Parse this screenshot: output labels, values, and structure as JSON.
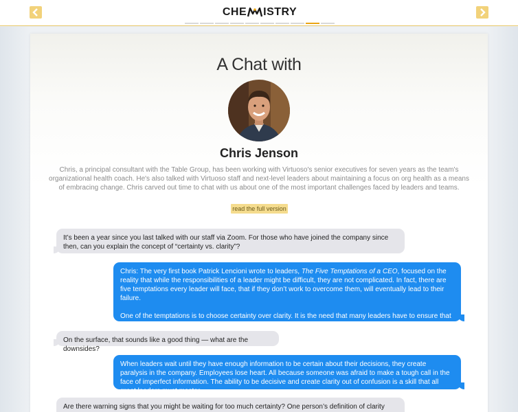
{
  "header": {
    "logo_text_left": "CHE",
    "logo_text_right": "ISTRY",
    "logo_accent_color": "#e9a412",
    "prev_icon": "chevron-left-icon",
    "next_icon": "chevron-right-icon",
    "progress": {
      "segments": 10,
      "active_index": 8
    }
  },
  "article": {
    "title": "A Chat with",
    "name": "Chris Jenson",
    "intro": "Chris, a principal consultant with the Table Group, has been working with Virtuoso's senior executives for seven years as the team's organizational health coach. He's also talked with Virtuoso staff and next-level leaders about maintaining a focus on org health as a means of embracing change. Chris carved out time to chat with us about one of the most important challenges faced by leaders and teams.",
    "read_button": "read the full version"
  },
  "chat": {
    "q1": "It’s been a year since you last talked with our staff via Zoom. For those who have joined the company since then, can you explain the concept of “certainty vs. clarity”?",
    "a1_p1_before": "Chris: The very first book Patrick Lencioni wrote to leaders, ",
    "a1_p1_book": "The Five Temptations of a CEO",
    "a1_p1_after": ", focused on the reality that while the responsibilities of a leader might be difficult, they are not complicated. In fact, there are five temptations every leader will face, that if they don’t work to overcome them, will eventually lead to their failure.",
    "a1_p2": "One of the temptations is to choose certainty over clarity. It is the need that many leaders have to ensure that their decisions are correct, accurate and precise.",
    "q2": "On the surface, that sounds like a good thing — what are the downsides?",
    "a2": "When leaders wait until they have enough information to be certain about their decisions, they create paralysis in the company. Employees lose heart. All because someone was afraid to make a tough call in the face of imperfect information. The ability to be decisive and create clarity out of confusion is a skill that all great leaders must master.",
    "q3": "Are there warning signs that you might be waiting for too much certainty? One person’s definition of clarity might be"
  },
  "colors": {
    "answer_bubble": "#1e8cf0",
    "question_bubble": "#e5e5ea",
    "button_bg": "#f5dc8e"
  }
}
